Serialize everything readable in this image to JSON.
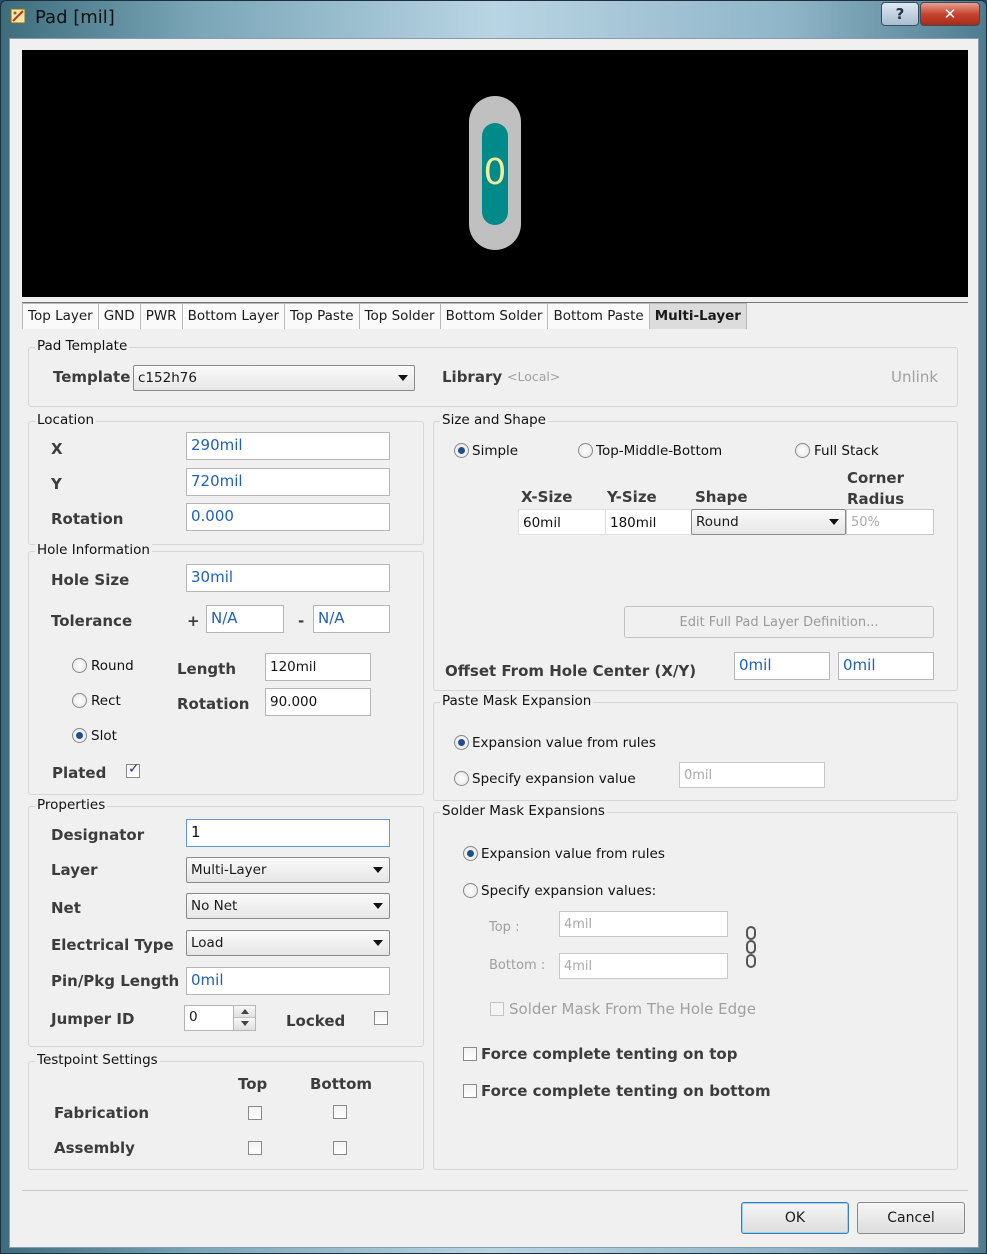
{
  "window": {
    "title": "Pad [mil]",
    "help_label": "?",
    "close_label": "✕"
  },
  "preview": {
    "pad_designator": "0"
  },
  "tabs": [
    {
      "label": "Top Layer"
    },
    {
      "label": "GND"
    },
    {
      "label": "PWR"
    },
    {
      "label": "Bottom Layer"
    },
    {
      "label": "Top Paste"
    },
    {
      "label": "Top Solder"
    },
    {
      "label": "Bottom Solder"
    },
    {
      "label": "Bottom Paste"
    },
    {
      "label": "Multi-Layer",
      "active": true
    }
  ],
  "pad_template": {
    "title": "Pad Template",
    "template_label": "Template",
    "template_value": "c152h76",
    "library_label": "Library",
    "library_value": "<Local>",
    "unlink_label": "Unlink"
  },
  "location": {
    "title": "Location",
    "x_label": "X",
    "x_value": "290mil",
    "y_label": "Y",
    "y_value": "720mil",
    "rotation_label": "Rotation",
    "rotation_value": "0.000"
  },
  "hole": {
    "title": "Hole Information",
    "size_label": "Hole Size",
    "size_value": "30mil",
    "tolerance_label": "Tolerance",
    "plus": "+",
    "plus_value": "N/A",
    "minus": "-",
    "minus_value": "N/A",
    "round_label": "Round",
    "rect_label": "Rect",
    "slot_label": "Slot",
    "selected": "Slot",
    "length_label": "Length",
    "length_value": "120mil",
    "rotation_label": "Rotation",
    "rotation_value": "90.000",
    "plated_label": "Plated",
    "plated": true
  },
  "properties": {
    "title": "Properties",
    "designator_label": "Designator",
    "designator_value": "1",
    "layer_label": "Layer",
    "layer_value": "Multi-Layer",
    "net_label": "Net",
    "net_value": "No Net",
    "etype_label": "Electrical Type",
    "etype_value": "Load",
    "pinpkg_label": "Pin/Pkg Length",
    "pinpkg_value": "0mil",
    "jumper_label": "Jumper ID",
    "jumper_value": "0",
    "locked_label": "Locked",
    "locked": false
  },
  "testpoint": {
    "title": "Testpoint Settings",
    "top_label": "Top",
    "bottom_label": "Bottom",
    "fab_label": "Fabrication",
    "asm_label": "Assembly"
  },
  "size_shape": {
    "title": "Size and Shape",
    "simple_label": "Simple",
    "tmb_label": "Top-Middle-Bottom",
    "full_label": "Full Stack",
    "selected": "Simple",
    "col_xsize": "X-Size",
    "col_ysize": "Y-Size",
    "col_shape": "Shape",
    "col_corner_1": "Corner",
    "col_corner_2": "Radius",
    "xsize_value": "60mil",
    "ysize_value": "180mil",
    "shape_value": "Round",
    "corner_value": "50%",
    "edit_button": "Edit Full Pad Layer Definition...",
    "offset_label": "Offset From Hole Center (X/Y)",
    "offset_x": "0mil",
    "offset_y": "0mil"
  },
  "paste_mask": {
    "title": "Paste Mask Expansion",
    "from_rules_label": "Expansion value from rules",
    "specify_label": "Specify expansion value",
    "specify_value": "0mil"
  },
  "solder_mask": {
    "title": "Solder Mask Expansions",
    "from_rules_label": "Expansion value from rules",
    "specify_label": "Specify expansion values:",
    "top_label": "Top :",
    "top_value": "4mil",
    "bottom_label": "Bottom :",
    "bottom_value": "4mil",
    "hole_edge_label": "Solder Mask From The Hole Edge",
    "tent_top_label": "Force complete tenting on top",
    "tent_bottom_label": "Force complete tenting on bottom"
  },
  "buttons": {
    "ok": "OK",
    "cancel": "Cancel"
  }
}
